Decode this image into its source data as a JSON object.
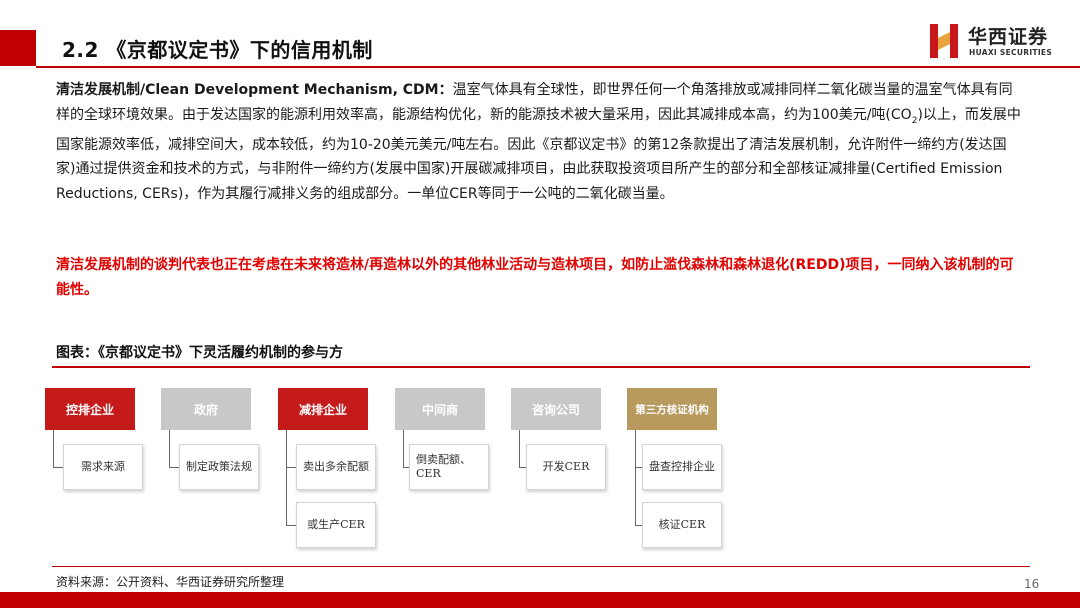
{
  "header": {
    "title": "2.2 《京都议定书》下的信用机制",
    "logo_cn": "华西证券",
    "logo_en": "HUAXI SECURITIES",
    "accent_color": "#c00000"
  },
  "content": {
    "lead_bold": "清洁发展机制/Clean Development Mechanism, CDM：",
    "paragraph_part1": "温室气体具有全球性，即世界任何一个角落排放或减排同样二氧化碳当量的温室气体具有同样的全球环境效果。由于发达国家的能源利用效率高，能源结构优化，新的能源技术被大量采用，因此其减排成本高，约为100美元/吨(CO",
    "co2_sub": "2",
    "paragraph_part2": ")以上，而发展中国家能源效率低，减排空间大，成本较低，约为10-20美元美元/吨左右。因此《京都议定书》的第12条款提出了清洁发展机制，允许附件一缔约方(发达国家)通过提供资金和技术的方式，与非附件一缔约方(发展中国家)开展碳减排项目，由此获取投资项目所产生的部分和全部核证减排量(Certified Emission Reductions, CERs)，作为其履行减排义务的组成部分。一单位CER等同于一公吨的二氧化碳当量。",
    "red_note": "清洁发展机制的谈判代表也正在考虑在未来将造林/再造林以外的其他林业活动与造林项目，如防止滥伐森林和森林退化(REDD)项目，一同纳入该机制的可能性。"
  },
  "figure": {
    "title": "图表：《京都议定书》下灵活履约机制的参与方",
    "columns": [
      {
        "header": "控排企业",
        "style": "red",
        "children": [
          "需求来源"
        ]
      },
      {
        "header": "政府",
        "style": "gray",
        "children": [
          "制定政策法规"
        ]
      },
      {
        "header": "减排企业",
        "style": "red",
        "children": [
          "卖出多余配额",
          "或生产CER"
        ]
      },
      {
        "header": "中间商",
        "style": "gray",
        "children": [
          "倒卖配额、CER"
        ]
      },
      {
        "header": "咨询公司",
        "style": "gray",
        "children": [
          "开发CER"
        ]
      },
      {
        "header": "第三方核证机构",
        "style": "gold",
        "children": [
          "盘查控排企业",
          "核证CER"
        ]
      }
    ]
  },
  "footer": {
    "source": "资料来源：公开资料、华西证券研究所整理",
    "page_number": "16"
  }
}
